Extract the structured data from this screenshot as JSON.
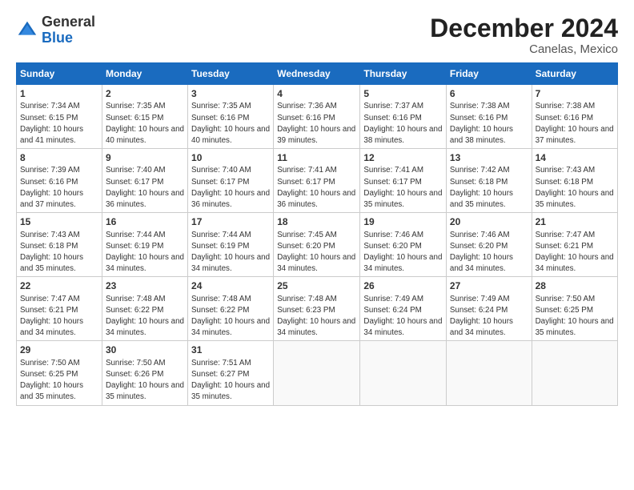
{
  "logo": {
    "general": "General",
    "blue": "Blue"
  },
  "title": "December 2024",
  "subtitle": "Canelas, Mexico",
  "days_of_week": [
    "Sunday",
    "Monday",
    "Tuesday",
    "Wednesday",
    "Thursday",
    "Friday",
    "Saturday"
  ],
  "weeks": [
    [
      {
        "day": "1",
        "sunrise": "7:34 AM",
        "sunset": "6:15 PM",
        "daylight": "10 hours and 41 minutes."
      },
      {
        "day": "2",
        "sunrise": "7:35 AM",
        "sunset": "6:15 PM",
        "daylight": "10 hours and 40 minutes."
      },
      {
        "day": "3",
        "sunrise": "7:35 AM",
        "sunset": "6:16 PM",
        "daylight": "10 hours and 40 minutes."
      },
      {
        "day": "4",
        "sunrise": "7:36 AM",
        "sunset": "6:16 PM",
        "daylight": "10 hours and 39 minutes."
      },
      {
        "day": "5",
        "sunrise": "7:37 AM",
        "sunset": "6:16 PM",
        "daylight": "10 hours and 38 minutes."
      },
      {
        "day": "6",
        "sunrise": "7:38 AM",
        "sunset": "6:16 PM",
        "daylight": "10 hours and 38 minutes."
      },
      {
        "day": "7",
        "sunrise": "7:38 AM",
        "sunset": "6:16 PM",
        "daylight": "10 hours and 37 minutes."
      }
    ],
    [
      {
        "day": "8",
        "sunrise": "7:39 AM",
        "sunset": "6:16 PM",
        "daylight": "10 hours and 37 minutes."
      },
      {
        "day": "9",
        "sunrise": "7:40 AM",
        "sunset": "6:17 PM",
        "daylight": "10 hours and 36 minutes."
      },
      {
        "day": "10",
        "sunrise": "7:40 AM",
        "sunset": "6:17 PM",
        "daylight": "10 hours and 36 minutes."
      },
      {
        "day": "11",
        "sunrise": "7:41 AM",
        "sunset": "6:17 PM",
        "daylight": "10 hours and 36 minutes."
      },
      {
        "day": "12",
        "sunrise": "7:41 AM",
        "sunset": "6:17 PM",
        "daylight": "10 hours and 35 minutes."
      },
      {
        "day": "13",
        "sunrise": "7:42 AM",
        "sunset": "6:18 PM",
        "daylight": "10 hours and 35 minutes."
      },
      {
        "day": "14",
        "sunrise": "7:43 AM",
        "sunset": "6:18 PM",
        "daylight": "10 hours and 35 minutes."
      }
    ],
    [
      {
        "day": "15",
        "sunrise": "7:43 AM",
        "sunset": "6:18 PM",
        "daylight": "10 hours and 35 minutes."
      },
      {
        "day": "16",
        "sunrise": "7:44 AM",
        "sunset": "6:19 PM",
        "daylight": "10 hours and 34 minutes."
      },
      {
        "day": "17",
        "sunrise": "7:44 AM",
        "sunset": "6:19 PM",
        "daylight": "10 hours and 34 minutes."
      },
      {
        "day": "18",
        "sunrise": "7:45 AM",
        "sunset": "6:20 PM",
        "daylight": "10 hours and 34 minutes."
      },
      {
        "day": "19",
        "sunrise": "7:46 AM",
        "sunset": "6:20 PM",
        "daylight": "10 hours and 34 minutes."
      },
      {
        "day": "20",
        "sunrise": "7:46 AM",
        "sunset": "6:20 PM",
        "daylight": "10 hours and 34 minutes."
      },
      {
        "day": "21",
        "sunrise": "7:47 AM",
        "sunset": "6:21 PM",
        "daylight": "10 hours and 34 minutes."
      }
    ],
    [
      {
        "day": "22",
        "sunrise": "7:47 AM",
        "sunset": "6:21 PM",
        "daylight": "10 hours and 34 minutes."
      },
      {
        "day": "23",
        "sunrise": "7:48 AM",
        "sunset": "6:22 PM",
        "daylight": "10 hours and 34 minutes."
      },
      {
        "day": "24",
        "sunrise": "7:48 AM",
        "sunset": "6:22 PM",
        "daylight": "10 hours and 34 minutes."
      },
      {
        "day": "25",
        "sunrise": "7:48 AM",
        "sunset": "6:23 PM",
        "daylight": "10 hours and 34 minutes."
      },
      {
        "day": "26",
        "sunrise": "7:49 AM",
        "sunset": "6:24 PM",
        "daylight": "10 hours and 34 minutes."
      },
      {
        "day": "27",
        "sunrise": "7:49 AM",
        "sunset": "6:24 PM",
        "daylight": "10 hours and 34 minutes."
      },
      {
        "day": "28",
        "sunrise": "7:50 AM",
        "sunset": "6:25 PM",
        "daylight": "10 hours and 35 minutes."
      }
    ],
    [
      {
        "day": "29",
        "sunrise": "7:50 AM",
        "sunset": "6:25 PM",
        "daylight": "10 hours and 35 minutes."
      },
      {
        "day": "30",
        "sunrise": "7:50 AM",
        "sunset": "6:26 PM",
        "daylight": "10 hours and 35 minutes."
      },
      {
        "day": "31",
        "sunrise": "7:51 AM",
        "sunset": "6:27 PM",
        "daylight": "10 hours and 35 minutes."
      },
      null,
      null,
      null,
      null
    ]
  ],
  "labels": {
    "sunrise": "Sunrise:",
    "sunset": "Sunset:",
    "daylight": "Daylight:"
  }
}
